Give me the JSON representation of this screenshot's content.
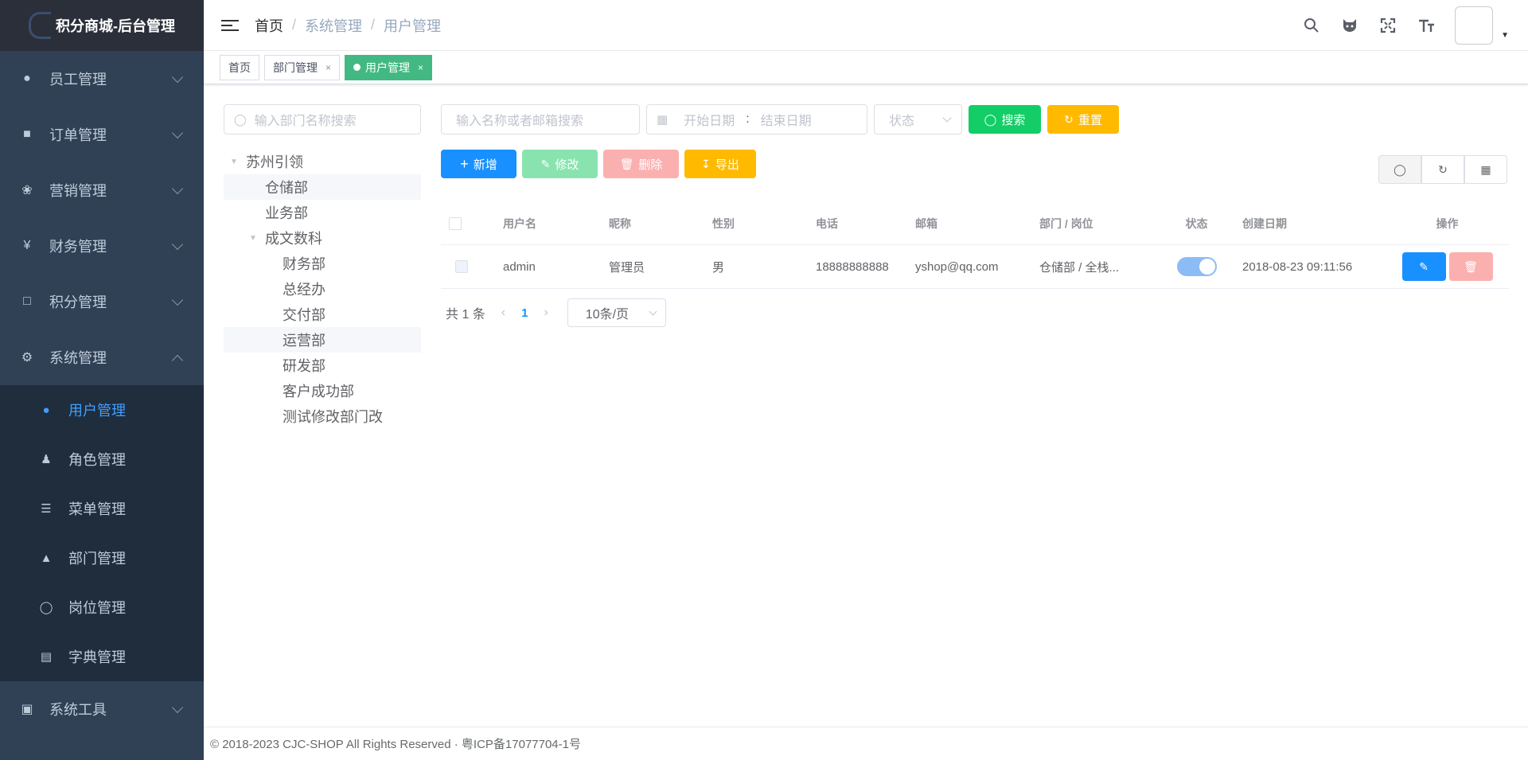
{
  "app": {
    "title": "积分商城-后台管理"
  },
  "sidebar": {
    "items": [
      {
        "label": "员工管理",
        "icon": "user-group-icon"
      },
      {
        "label": "订单管理",
        "icon": "lock-icon"
      },
      {
        "label": "营销管理",
        "icon": "palette-icon"
      },
      {
        "label": "财务管理",
        "icon": "yen-icon"
      },
      {
        "label": "积分管理",
        "icon": "calendar-icon"
      },
      {
        "label": "系统管理",
        "icon": "gear-icon",
        "expanded": true
      }
    ],
    "sub_items": [
      {
        "label": "用户管理",
        "icon": "people-icon",
        "active": true
      },
      {
        "label": "角色管理",
        "icon": "role-icon"
      },
      {
        "label": "菜单管理",
        "icon": "menu-list-icon"
      },
      {
        "label": "部门管理",
        "icon": "dept-tree-icon"
      },
      {
        "label": "岗位管理",
        "icon": "post-icon"
      },
      {
        "label": "字典管理",
        "icon": "dict-icon"
      }
    ],
    "tools": {
      "label": "系统工具",
      "icon": "toolbox-icon"
    }
  },
  "header": {
    "breadcrumb": [
      "首页",
      "系统管理",
      "用户管理"
    ],
    "icons": [
      "search-icon",
      "github-icon",
      "fullscreen-icon",
      "font-size-icon"
    ]
  },
  "tags": [
    {
      "label": "首页"
    },
    {
      "label": "部门管理",
      "closable": true
    },
    {
      "label": "用户管理",
      "closable": true,
      "active": true
    }
  ],
  "dept": {
    "search_placeholder": "输入部门名称搜索",
    "tree": [
      {
        "label": "苏州引领",
        "level": 0,
        "expandable": true
      },
      {
        "label": "仓储部",
        "level": 1,
        "highlight": true
      },
      {
        "label": "业务部",
        "level": 1
      },
      {
        "label": "成文数科",
        "level": 1,
        "expandable": true
      },
      {
        "label": "财务部",
        "level": 2
      },
      {
        "label": "总经办",
        "level": 2
      },
      {
        "label": "交付部",
        "level": 2
      },
      {
        "label": "运营部",
        "level": 2,
        "highlight": true
      },
      {
        "label": "研发部",
        "level": 2
      },
      {
        "label": "客户成功部",
        "level": 2
      },
      {
        "label": "测试修改部门改",
        "level": 2
      }
    ]
  },
  "filters": {
    "keyword_placeholder": "输入名称或者邮箱搜索",
    "start_placeholder": "开始日期",
    "range_sep": ":",
    "end_placeholder": "结束日期",
    "status_placeholder": "状态",
    "search_label": "搜索",
    "reset_label": "重置"
  },
  "crud": {
    "add_label": "新增",
    "edit_label": "修改",
    "delete_label": "删除",
    "export_label": "导出"
  },
  "table": {
    "columns": [
      "用户名",
      "昵称",
      "性别",
      "电话",
      "邮箱",
      "部门 / 岗位",
      "状态",
      "创建日期",
      "操作"
    ],
    "rows": [
      {
        "username": "admin",
        "nickname": "管理员",
        "gender": "男",
        "phone": "18888888888",
        "email": "yshop@qq.com",
        "dept": "仓储部 / 全栈...",
        "enabled": true,
        "created": "2018-08-23 09:11:56"
      }
    ]
  },
  "pagination": {
    "total_text": "共 1 条",
    "current": "1",
    "page_size": "10条/页"
  },
  "footer": {
    "text": "© 2018-2023 CJC-SHOP All Rights Reserved · 粤ICP备17077704-1号"
  },
  "colors": {
    "sidebar_bg": "#304156",
    "submenu_bg": "#1f2d3d",
    "active": "#409eff",
    "tag_active": "#42b983"
  }
}
